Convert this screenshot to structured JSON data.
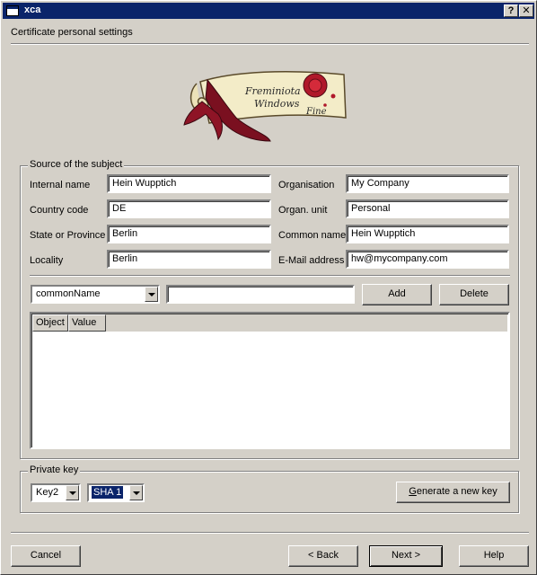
{
  "window": {
    "title": "xca",
    "help_glyph": "?",
    "close_glyph": "✕"
  },
  "header": {
    "text": "Certificate personal settings",
    "logo_line1": "Freminiota",
    "logo_line2": "Windows",
    "logo_line3": "Fine"
  },
  "subject": {
    "legend": "Source of the subject",
    "fields": {
      "internal_name": {
        "label": "Internal name",
        "value": "Hein Wupptich"
      },
      "country_code": {
        "label": "Country code",
        "value": "DE"
      },
      "state": {
        "label": "State or Province",
        "value": "Berlin"
      },
      "locality": {
        "label": "Locality",
        "value": "Berlin"
      },
      "organisation": {
        "label": "Organisation",
        "value": "My Company"
      },
      "organ_unit": {
        "label": "Organ. unit",
        "value": "Personal"
      },
      "common_name": {
        "label": "Common name",
        "value": "Hein Wupptich"
      },
      "email": {
        "label": "E-Mail address",
        "value": "hw@mycompany.com"
      }
    },
    "attribute_select": "commonName",
    "attribute_value": "",
    "add_label": "Add",
    "delete_label": "Delete",
    "table": {
      "columns": [
        "Object",
        "Value"
      ],
      "rows": []
    }
  },
  "private_key": {
    "legend": "Private key",
    "key_select": "Key2",
    "hash_select": "SHA 1",
    "generate_label": "Generate a new key"
  },
  "footer": {
    "cancel_label": "Cancel",
    "back_label": "< Back",
    "next_label": "Next >",
    "help_label": "Help"
  },
  "colors": {
    "titlebar": "#0a246a",
    "face": "#d4d0c8",
    "selection": "#0a246a"
  }
}
